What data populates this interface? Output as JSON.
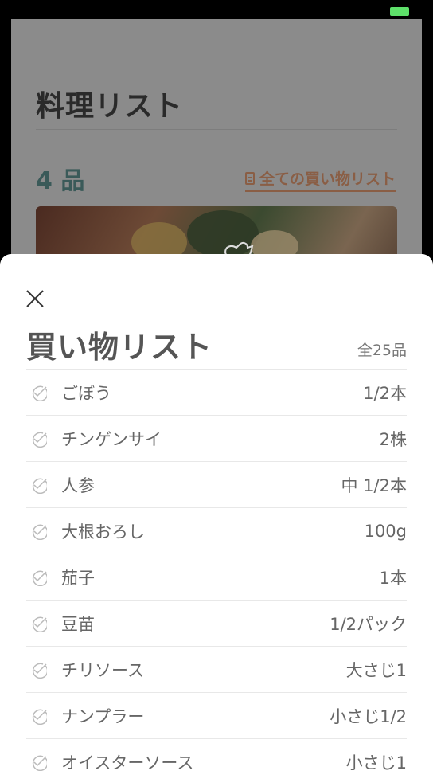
{
  "background_page": {
    "title": "料理リスト",
    "dish_count": "4 品",
    "all_shopping_list_link": "全ての買い物リスト"
  },
  "sheet": {
    "title": "買い物リスト",
    "total": "全25品",
    "items": [
      {
        "name": "ごぼう",
        "qty": "1/2本"
      },
      {
        "name": "チンゲンサイ",
        "qty": "2株"
      },
      {
        "name": "人参",
        "qty": "中 1/2本"
      },
      {
        "name": "大根おろし",
        "qty": "100g"
      },
      {
        "name": "茄子",
        "qty": "1本"
      },
      {
        "name": "豆苗",
        "qty": "1/2パック"
      },
      {
        "name": "チリソース",
        "qty": "大さじ1"
      },
      {
        "name": "ナンプラー",
        "qty": "小さじ1/2"
      },
      {
        "name": "オイスターソース",
        "qty": "小さじ1"
      }
    ]
  },
  "colors": {
    "overlay": "#8b8b8b",
    "accent_teal": "#3a5a59",
    "link_brown": "#8a5e45",
    "battery": "#5ee06a"
  },
  "icons": [
    "close-icon",
    "check-circle-icon",
    "document-icon",
    "like-icon",
    "battery-icon"
  ]
}
